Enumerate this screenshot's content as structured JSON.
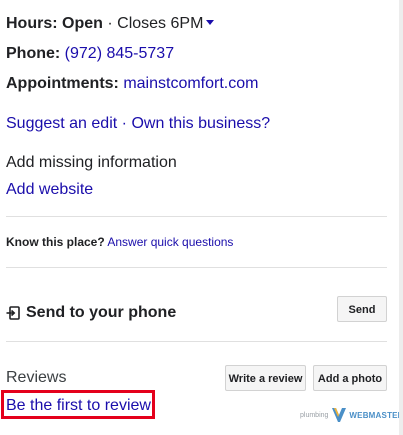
{
  "hours": {
    "label": "Hours:",
    "status": "Open",
    "separator": "·",
    "closes": "Closes 6PM"
  },
  "phone": {
    "label": "Phone:",
    "value": "(972) 845-5737"
  },
  "appointments": {
    "label": "Appointments:",
    "value": "mainstcomfort.com"
  },
  "edit_links": {
    "suggest": "Suggest an edit",
    "separator": "·",
    "own": "Own this business?"
  },
  "missing": {
    "title": "Add missing information",
    "add_website": "Add website"
  },
  "know": {
    "label": "Know this place?",
    "link": "Answer quick questions"
  },
  "send": {
    "title": "Send to your phone",
    "button": "Send"
  },
  "reviews": {
    "title": "Reviews",
    "write_button": "Write a review",
    "photo_button": "Add a photo",
    "first_link": "Be the first to review"
  },
  "watermark": {
    "small": "plumbing",
    "big": "WEBMASTERS"
  },
  "colors": {
    "link": "#1a0dab",
    "highlight": "#e4001b",
    "watermark": "#4a8fc7"
  }
}
